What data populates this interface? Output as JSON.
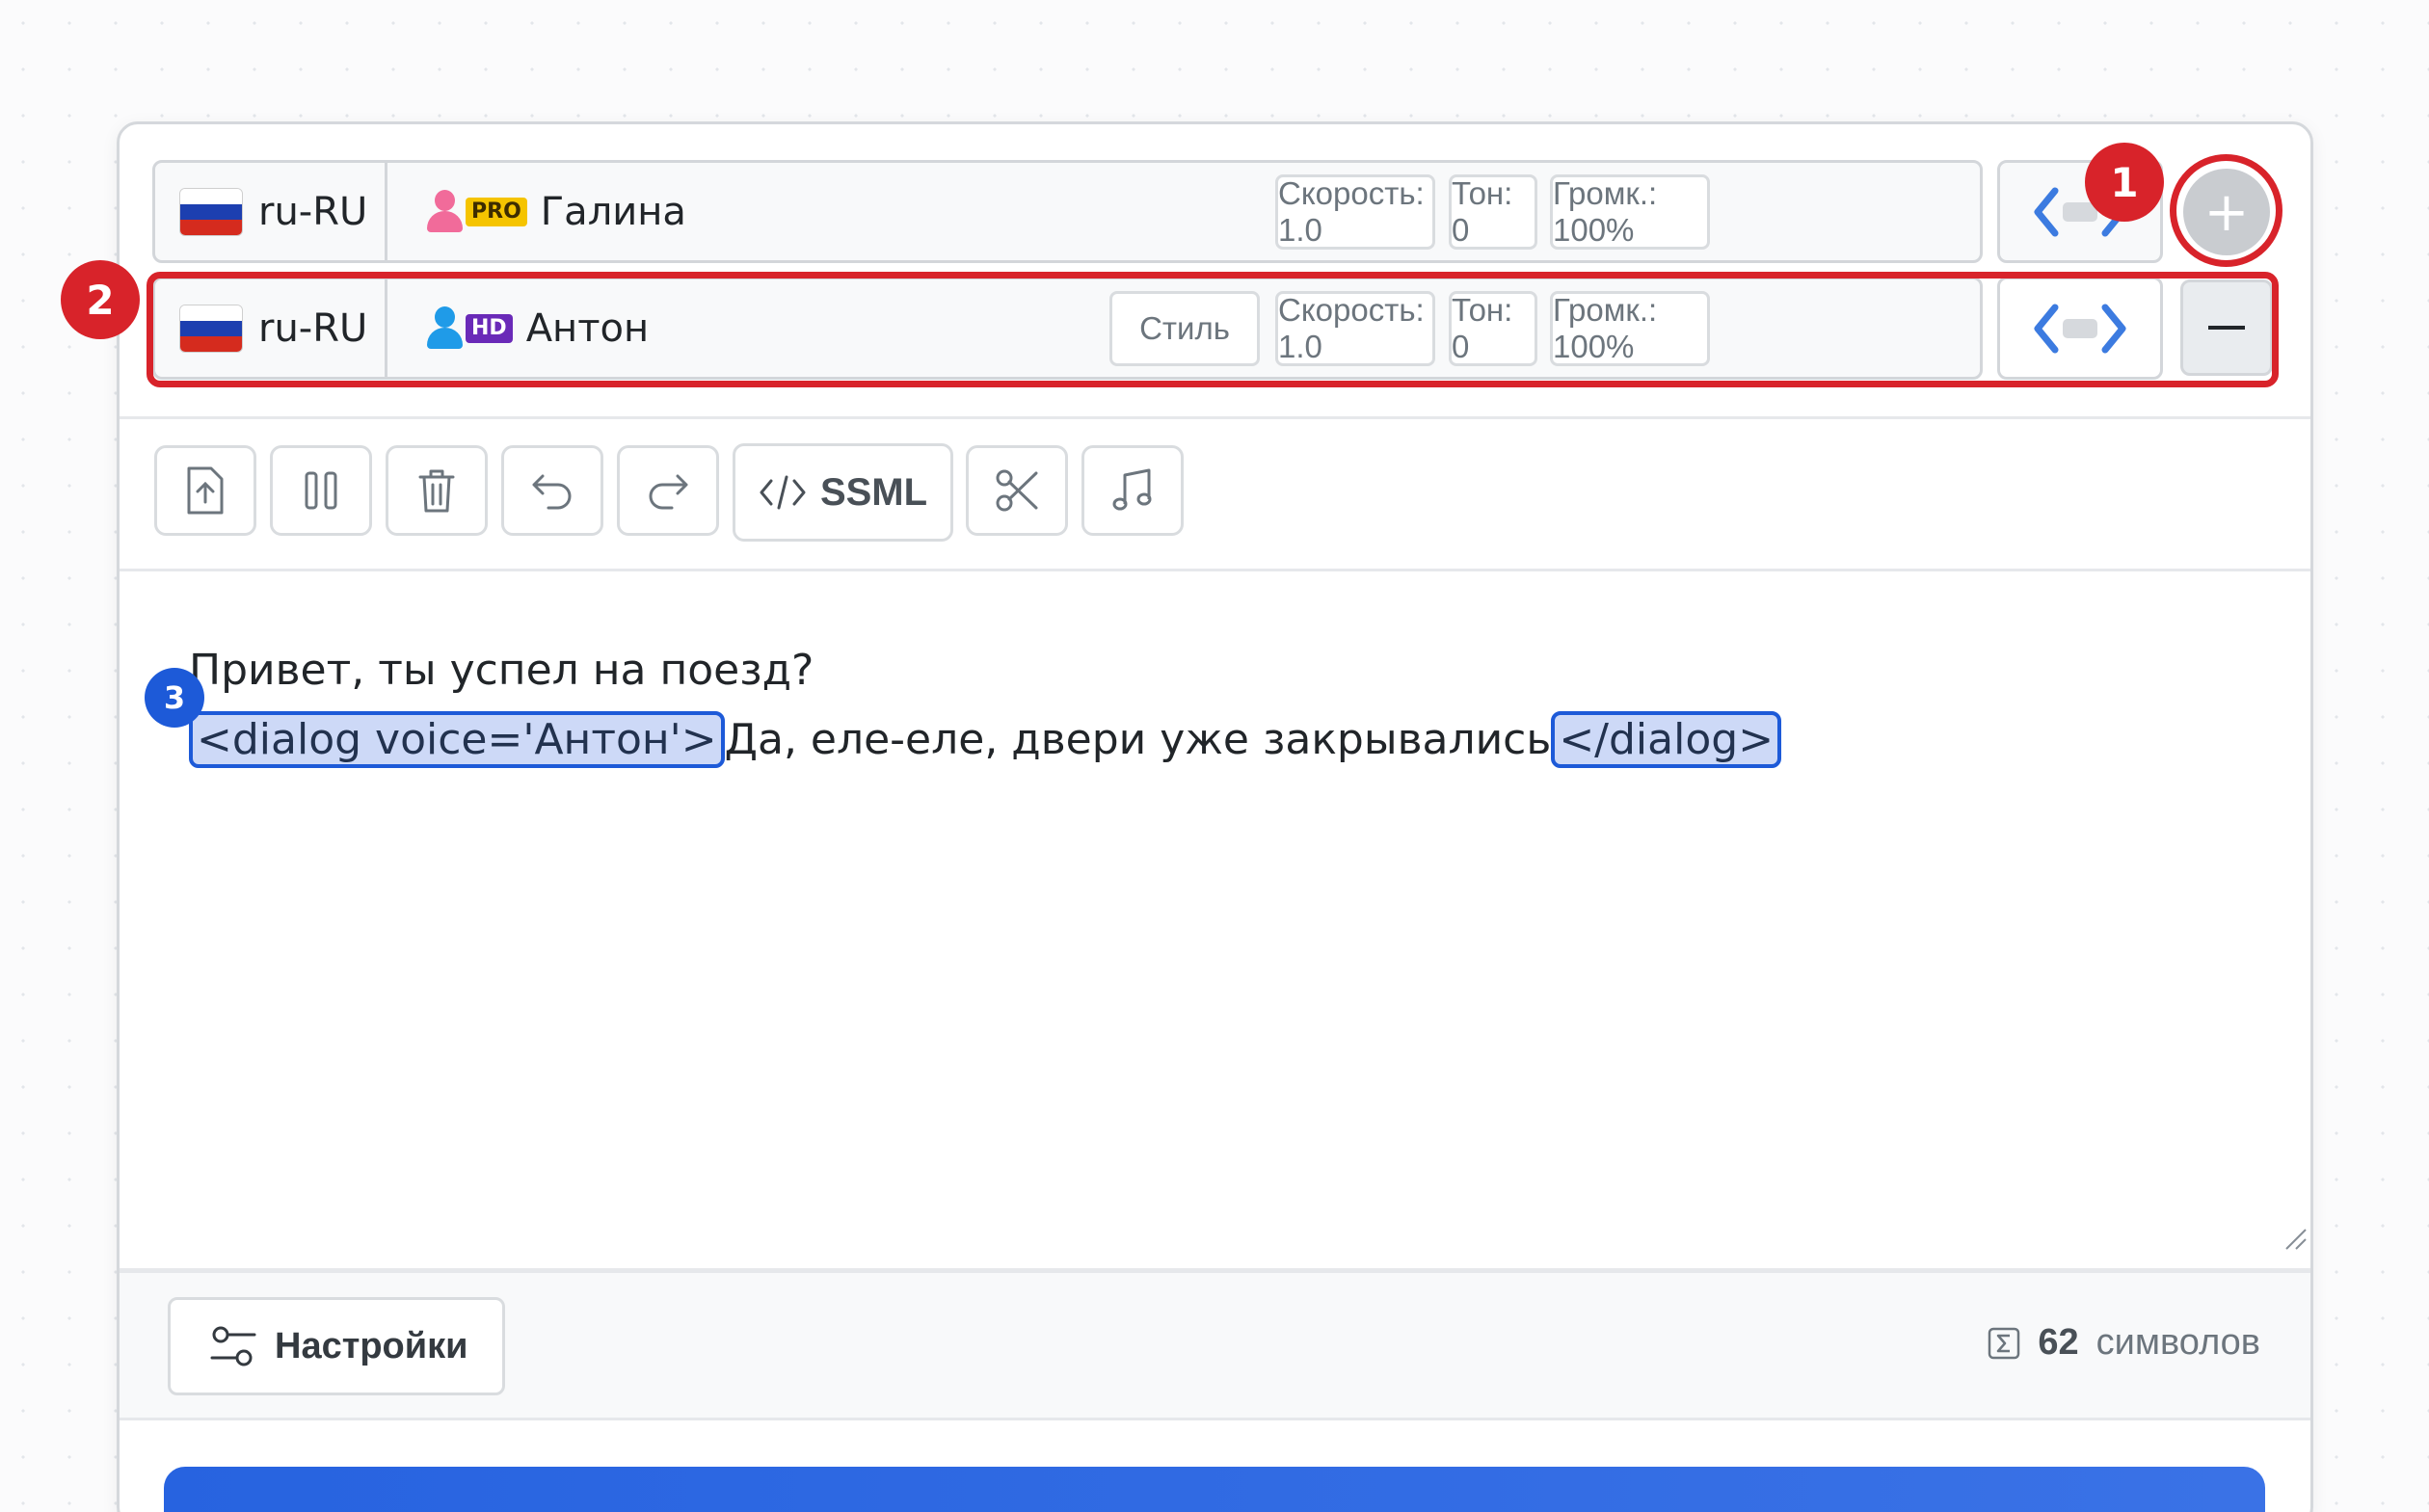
{
  "voices": [
    {
      "lang": "ru-RU",
      "badge": "PRO",
      "name": "Галина",
      "speed": "Скорость: 1.0",
      "tone": "Тон: 0",
      "volume": "Громк.: 100%"
    },
    {
      "lang": "ru-RU",
      "badge": "HD",
      "name": "Антон",
      "style": "Стиль",
      "speed": "Скорость: 1.0",
      "tone": "Тон: 0",
      "volume": "Громк.: 100%"
    }
  ],
  "buttons": {
    "add": "+"
  },
  "toolbar": {
    "ssml_label": "SSML",
    "icons": [
      "upload-icon",
      "pause-icon",
      "trash-icon",
      "undo-icon",
      "redo-icon",
      "code-icon",
      "scissors-icon",
      "music-icon"
    ]
  },
  "editor": {
    "line1": "Привет, ты успел на поезд?",
    "open_tag": "<dialog voice='Антон'>",
    "line2_text": "Да, еле-еле, двери уже закрывались",
    "close_tag": "</dialog>"
  },
  "footer": {
    "settings_label": "Настройки",
    "char_count": "62",
    "char_unit": "символов"
  },
  "annotations": [
    "1",
    "2",
    "3"
  ],
  "colors": {
    "annotation_red": "#d8232a",
    "annotation_blue": "#1d5ad8",
    "accent_blue": "#2763e0",
    "pro_badge": "#f5c400",
    "hd_badge": "#6a2ab8"
  }
}
